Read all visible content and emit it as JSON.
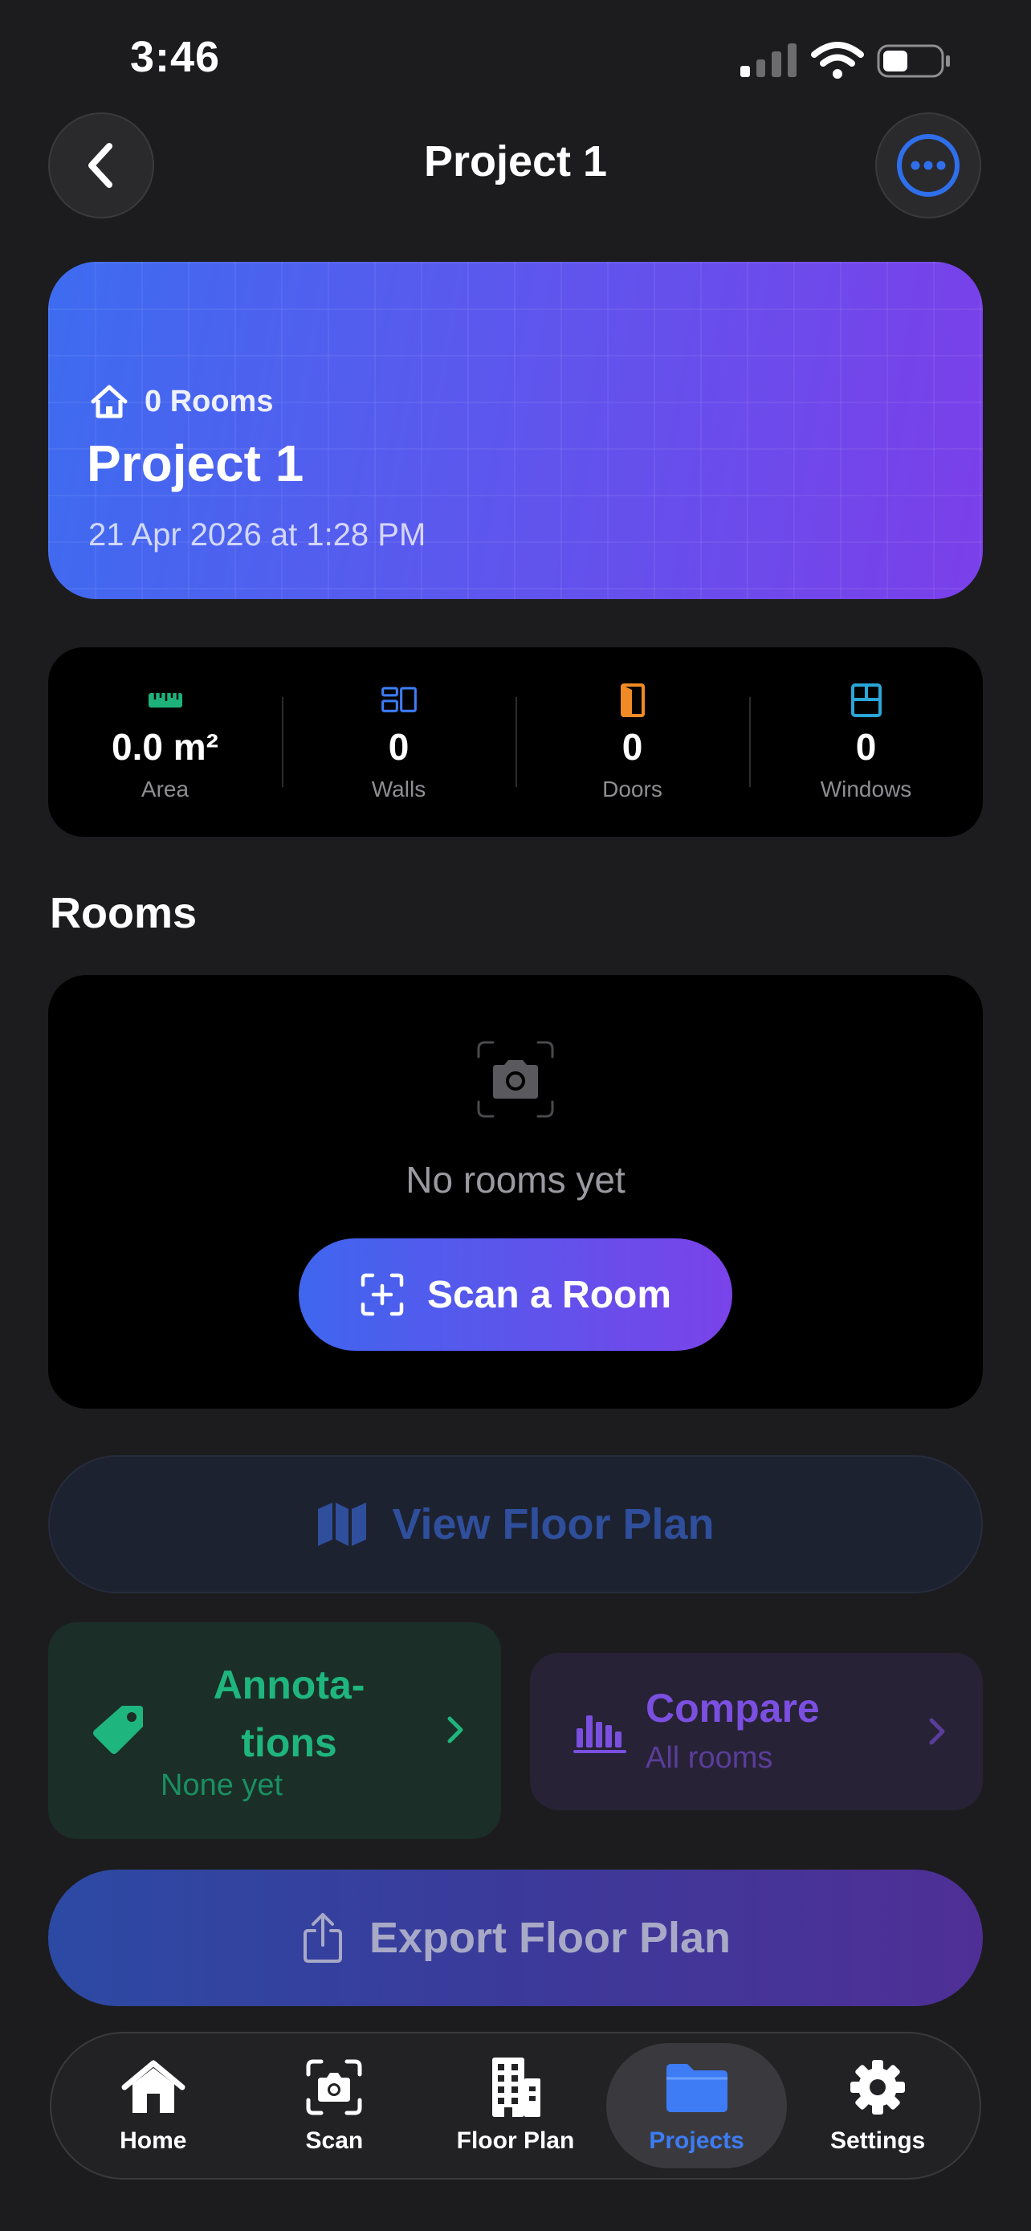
{
  "status": {
    "time": "3:46"
  },
  "nav": {
    "title": "Project 1"
  },
  "hero": {
    "rooms": "0 Rooms",
    "title": "Project 1",
    "date": "21 Apr 2026 at 1:28 PM"
  },
  "stats": [
    {
      "value": "0.0 m²",
      "label": "Area",
      "icon": "ruler-icon",
      "color": "#1db27a"
    },
    {
      "value": "0",
      "label": "Walls",
      "icon": "walls-icon",
      "color": "#3d7cf5"
    },
    {
      "value": "0",
      "label": "Doors",
      "icon": "door-icon",
      "color": "#f08a24"
    },
    {
      "value": "0",
      "label": "Windows",
      "icon": "window-icon",
      "color": "#2aa6d8"
    }
  ],
  "rooms": {
    "section_title": "Rooms",
    "empty_text": "No rooms yet",
    "scan_button": "Scan a Room"
  },
  "actions": {
    "view_floor_plan": "View Floor Plan",
    "annotations_title": "Annota-\ntions",
    "annotations_sub": "None yet",
    "compare_title": "Compare",
    "compare_sub": "All rooms",
    "export": "Export Floor Plan"
  },
  "tabs": [
    {
      "label": "Home",
      "icon": "house-icon"
    },
    {
      "label": "Scan",
      "icon": "camera-scan-icon"
    },
    {
      "label": "Floor Plan",
      "icon": "building-icon"
    },
    {
      "label": "Projects",
      "icon": "folder-icon",
      "active": true
    },
    {
      "label": "Settings",
      "icon": "gear-icon"
    }
  ],
  "colors": {
    "accent": "#3d7cf5",
    "annotation": "#1fb57f",
    "compare": "#7b4fe0",
    "background": "#1c1c1e"
  }
}
